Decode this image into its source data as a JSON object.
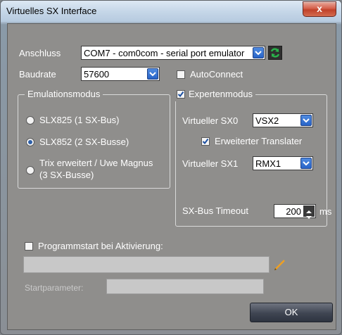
{
  "window": {
    "title": "Virtuelles SX Interface",
    "close_label": "x"
  },
  "connection": {
    "anschluss_label": "Anschluss",
    "anschluss_value": "COM7 - com0com - serial port emulator",
    "baudrate_label": "Baudrate",
    "baudrate_value": "57600",
    "autoconnect_label": "AutoConnect"
  },
  "emulation": {
    "legend": "Emulationsmodus",
    "options": [
      {
        "label": "SLX825 (1 SX-Bus)",
        "selected": false
      },
      {
        "label": "SLX852 (2 SX-Busse)",
        "selected": true
      },
      {
        "label_line1": "Trix erweitert / Uwe Magnus",
        "label_line2": "(3 SX-Busse)",
        "selected": false
      }
    ]
  },
  "expert": {
    "legend": "Expertenmodus",
    "sx0_label": "Virtueller SX0",
    "sx0_value": "VSX2",
    "translater_label": "Erweiterter Translater",
    "sx1_label": "Virtueller SX1",
    "sx1_value": "RMX1",
    "timeout_label": "SX-Bus Timeout",
    "timeout_value": "200",
    "timeout_unit": "ms"
  },
  "program": {
    "start_label": "Programmstart bei Aktivierung:",
    "path_value": "",
    "parameter_label": "Startparameter:",
    "parameter_value": ""
  },
  "footer": {
    "ok_label": "OK"
  },
  "colors": {
    "accent": "#2864c8",
    "close": "#c0412a"
  }
}
